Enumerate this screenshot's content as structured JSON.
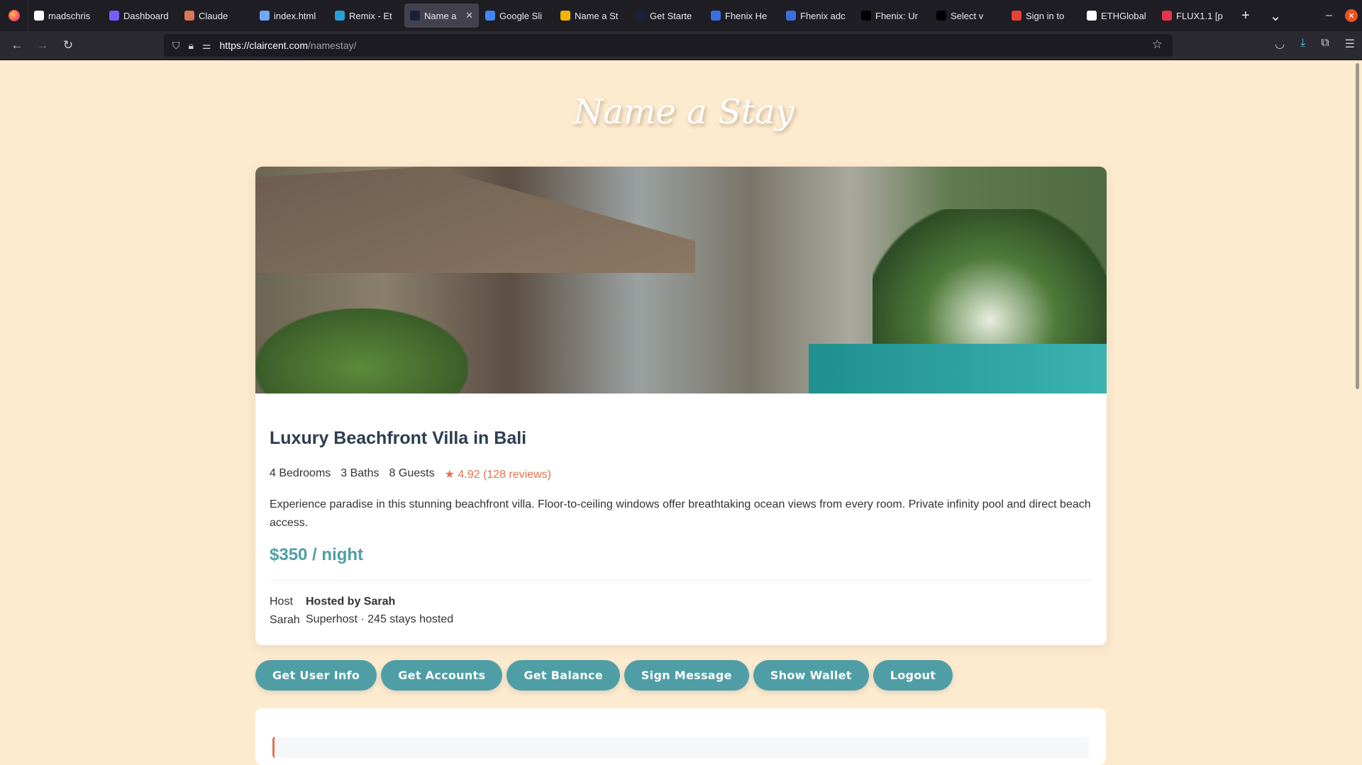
{
  "browser": {
    "tabs": [
      {
        "label": "madschris",
        "icon": "github-icon",
        "color": "#ffffff"
      },
      {
        "label": "Dashboard",
        "icon": "dashboard-icon",
        "color": "#7b5cff"
      },
      {
        "label": "Claude",
        "icon": "claude-icon",
        "color": "#d97757"
      },
      {
        "label": "index.html",
        "icon": "file-icon",
        "color": "#6ea8ff"
      },
      {
        "label": "Remix - Et",
        "icon": "remix-icon",
        "color": "#2a9fd6"
      },
      {
        "label": "Name a",
        "icon": "site-icon",
        "color": "#1a1f3a",
        "active": true
      },
      {
        "label": "Google Sli",
        "icon": "google-icon",
        "color": "#4285f4"
      },
      {
        "label": "Name a St",
        "icon": "slides-icon",
        "color": "#f4b400"
      },
      {
        "label": "Get Starte",
        "icon": "site-icon",
        "color": "#1a1f3a"
      },
      {
        "label": "Fhenix He",
        "icon": "fhenix-icon",
        "color": "#3a6fe0"
      },
      {
        "label": "Fhenix adc",
        "icon": "fhenix-icon",
        "color": "#3a6fe0"
      },
      {
        "label": "Fhenix: Ur",
        "icon": "fhenix-icon",
        "color": "#000000"
      },
      {
        "label": "Select v",
        "icon": "palm-icon",
        "color": "#000000"
      },
      {
        "label": "Sign in to",
        "icon": "gmail-icon",
        "color": "#ea4335"
      },
      {
        "label": "ETHGlobal",
        "icon": "ethglobal-icon",
        "color": "#ffffff"
      },
      {
        "label": "FLUX1.1 [p",
        "icon": "flux-icon",
        "color": "#e8344e"
      }
    ],
    "url_host": "https://claircent.com",
    "url_path": "/namestay/"
  },
  "site": {
    "title": "Name a Stay"
  },
  "listing": {
    "title": "Luxury Beachfront Villa in Bali",
    "bedrooms": "4 Bedrooms",
    "baths": "3 Baths",
    "guests": "8 Guests",
    "rating": "★ 4.92 (128 reviews)",
    "description": "Experience paradise in this stunning beachfront villa. Floor-to-ceiling windows offer breathtaking ocean views from every room. Private infinity pool and direct beach access.",
    "price": "$350 / night",
    "host_avatar_alt": "Host Sarah",
    "host_name": "Hosted by Sarah",
    "host_sub": "Superhost · 245 stays hosted"
  },
  "actions": [
    "Get User Info",
    "Get Accounts",
    "Get Balance",
    "Sign Message",
    "Show Wallet",
    "Logout"
  ],
  "colors": {
    "background": "#fdebd0",
    "accent": "#4f9ea6",
    "rating": "#e8704f",
    "heading": "#2c3e50"
  }
}
